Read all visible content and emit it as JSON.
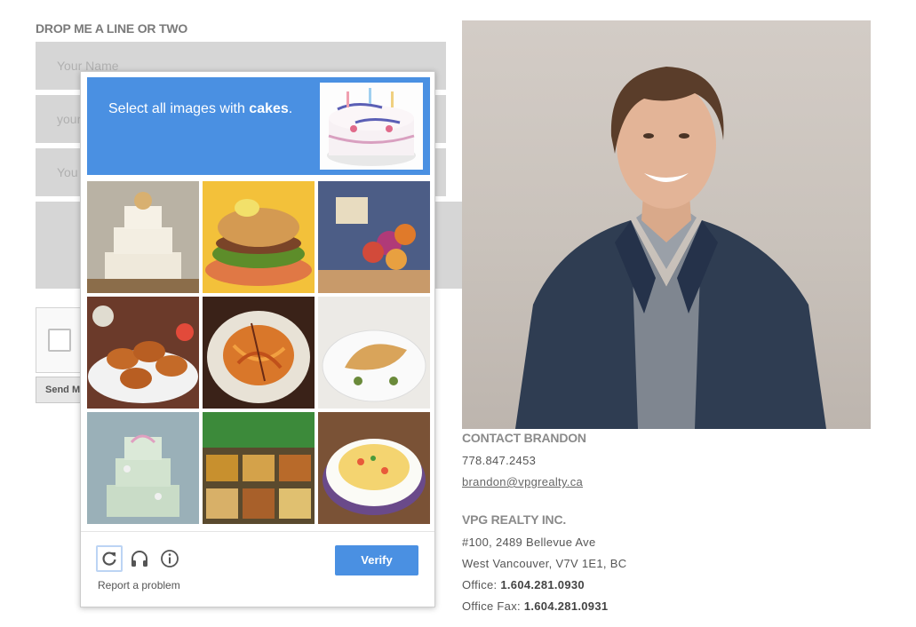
{
  "form": {
    "title": "DROP ME A LINE OR TWO",
    "name_placeholder": "Your Name",
    "email_placeholder": "your",
    "phone_placeholder": "You",
    "send_label": "Send M"
  },
  "contact": {
    "heading": "CONTACT BRANDON",
    "phone": "778.847.2453",
    "email": "brandon@vpgrealty.ca"
  },
  "company": {
    "name": "VPG REALTY INC.",
    "address1": "#100, 2489 Bellevue Ave",
    "address2": "West Vancouver, V7V 1E1, BC",
    "office_label": "Office: ",
    "office_phone": "1.604.281.0930",
    "fax_label": "Office Fax: ",
    "fax_phone": "1.604.281.0931"
  },
  "captcha": {
    "prompt_prefix": "Select all images with ",
    "prompt_target": "cakes",
    "prompt_suffix": ".",
    "verify_label": "Verify",
    "report_label": "Report a problem",
    "accent": "#4a90e2",
    "tiles": [
      "tiered-cake",
      "burger",
      "flower-centerpiece",
      "fried-shrimp",
      "spaghetti",
      "empanada",
      "wedding-cake",
      "buffet-trays",
      "omelette"
    ]
  }
}
